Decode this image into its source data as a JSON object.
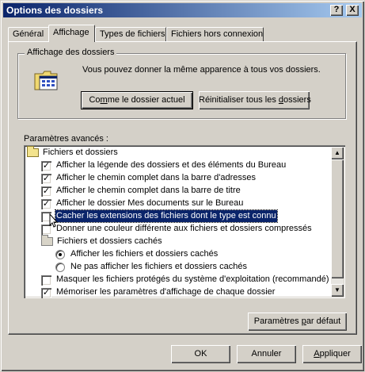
{
  "window": {
    "title": "Options des dossiers",
    "help_label": "?",
    "close_label": "X"
  },
  "tabs": [
    {
      "label": "Général",
      "active": false
    },
    {
      "label": "Affichage",
      "active": true
    },
    {
      "label": "Types de fichiers",
      "active": false
    },
    {
      "label": "Fichiers hors connexion",
      "active": false
    }
  ],
  "folder_view": {
    "group_label": "Affichage des dossiers",
    "description": "Vous pouvez donner la même apparence à tous vos dossiers.",
    "btn_current": {
      "pre": "Co",
      "u": "m",
      "post": "me le dossier actuel"
    },
    "btn_reset": {
      "pre": "Réinitialiser tous les ",
      "u": "d",
      "post": "ossiers"
    }
  },
  "advanced": {
    "label": "Paramètres avancés :",
    "items": [
      {
        "kind": "folder",
        "indent": 0,
        "label": "Fichiers et dossiers"
      },
      {
        "kind": "checkbox",
        "indent": 1,
        "checked": true,
        "label": "Afficher la légende des dossiers et des éléments du Bureau"
      },
      {
        "kind": "checkbox",
        "indent": 1,
        "checked": true,
        "label": "Afficher le chemin complet dans la barre d'adresses"
      },
      {
        "kind": "checkbox",
        "indent": 1,
        "checked": true,
        "label": "Afficher le chemin complet dans la barre de titre"
      },
      {
        "kind": "checkbox",
        "indent": 1,
        "checked": true,
        "label": "Afficher le dossier Mes documents sur le Bureau"
      },
      {
        "kind": "checkbox",
        "indent": 1,
        "checked": false,
        "selected": true,
        "label": "Cacher les extensions des fichiers dont le type est connu"
      },
      {
        "kind": "checkbox",
        "indent": 1,
        "checked": false,
        "label": "Donner une couleur différente aux fichiers et dossiers compressés"
      },
      {
        "kind": "folder",
        "indent": 1,
        "label": "Fichiers et dossiers cachés"
      },
      {
        "kind": "radio",
        "indent": 2,
        "checked": true,
        "label": "Afficher les fichiers et dossiers cachés"
      },
      {
        "kind": "radio",
        "indent": 2,
        "checked": false,
        "label": "Ne pas afficher les fichiers et dossiers cachés"
      },
      {
        "kind": "checkbox",
        "indent": 1,
        "checked": false,
        "label": "Masquer les fichiers protégés du système d'exploitation (recommandé)"
      },
      {
        "kind": "checkbox",
        "indent": 1,
        "checked": true,
        "label": "Mémoriser les paramètres d'affichage de chaque dossier"
      }
    ]
  },
  "buttons": {
    "defaults": {
      "pre": "Paramètres ",
      "u": "p",
      "post": "ar défaut"
    },
    "ok": "OK",
    "cancel": "Annuler",
    "apply": {
      "pre": "",
      "u": "A",
      "post": "ppliquer"
    }
  },
  "colors": {
    "face": "#d4d0c8",
    "title_start": "#0a246a",
    "title_end": "#a6caf0",
    "selection": "#0a246a"
  }
}
